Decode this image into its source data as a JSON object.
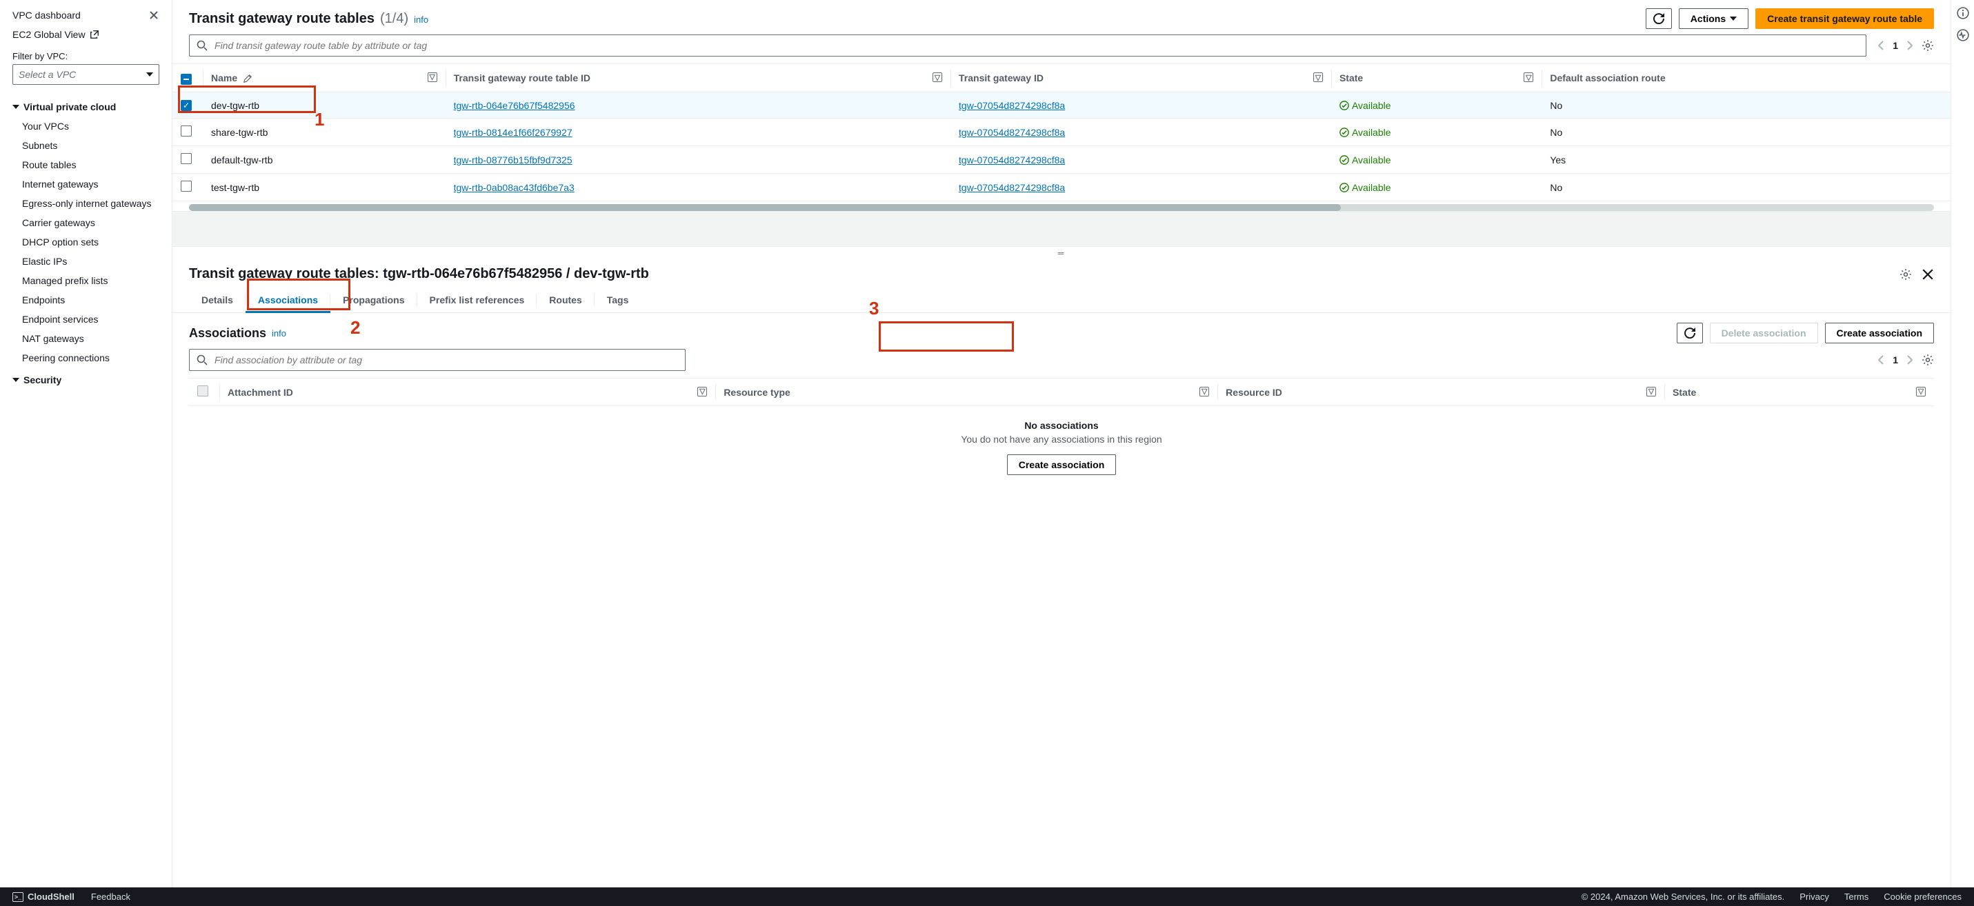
{
  "sidebar": {
    "dashboard": "VPC dashboard",
    "ec2_global": "EC2 Global View",
    "filter_label": "Filter by VPC:",
    "filter_placeholder": "Select a VPC",
    "section_vpc": "Virtual private cloud",
    "links_vpc": [
      "Your VPCs",
      "Subnets",
      "Route tables",
      "Internet gateways",
      "Egress-only internet gateways",
      "Carrier gateways",
      "DHCP option sets",
      "Elastic IPs",
      "Managed prefix lists",
      "Endpoints",
      "Endpoint services",
      "NAT gateways",
      "Peering connections"
    ],
    "section_security": "Security"
  },
  "header": {
    "title": "Transit gateway route tables",
    "count": "(1/4)",
    "info": "info",
    "actions_label": "Actions",
    "create_label": "Create transit gateway route table",
    "search_placeholder": "Find transit gateway route table by attribute or tag",
    "page": "1"
  },
  "table": {
    "cols": [
      "Name",
      "Transit gateway route table ID",
      "Transit gateway ID",
      "State",
      "Default association route"
    ],
    "rows": [
      {
        "selected": true,
        "name": "dev-tgw-rtb",
        "rtid": "tgw-rtb-064e76b67f5482956",
        "tgid": "tgw-07054d8274298cf8a",
        "state": "Available",
        "def": "No"
      },
      {
        "selected": false,
        "name": "share-tgw-rtb",
        "rtid": "tgw-rtb-0814e1f66f2679927",
        "tgid": "tgw-07054d8274298cf8a",
        "state": "Available",
        "def": "No"
      },
      {
        "selected": false,
        "name": "default-tgw-rtb",
        "rtid": "tgw-rtb-08776b15fbf9d7325",
        "tgid": "tgw-07054d8274298cf8a",
        "state": "Available",
        "def": "Yes"
      },
      {
        "selected": false,
        "name": "test-tgw-rtb",
        "rtid": "tgw-rtb-0ab08ac43fd6be7a3",
        "tgid": "tgw-07054d8274298cf8a",
        "state": "Available",
        "def": "No"
      }
    ]
  },
  "detail": {
    "title": "Transit gateway route tables: tgw-rtb-064e76b67f5482956 / dev-tgw-rtb",
    "tabs": [
      "Details",
      "Associations",
      "Propagations",
      "Prefix list references",
      "Routes",
      "Tags"
    ],
    "active_tab": 1,
    "assoc_title": "Associations",
    "info": "info",
    "delete_label": "Delete association",
    "create_label": "Create association",
    "search_placeholder": "Find association by attribute or tag",
    "page": "1",
    "cols": [
      "Attachment ID",
      "Resource type",
      "Resource ID",
      "State"
    ],
    "empty_title": "No associations",
    "empty_sub": "You do not have any associations in this region",
    "empty_btn": "Create association"
  },
  "footer": {
    "cloudshell": "CloudShell",
    "feedback": "Feedback",
    "copyright": "© 2024, Amazon Web Services, Inc. or its affiliates.",
    "privacy": "Privacy",
    "terms": "Terms",
    "cookie": "Cookie preferences"
  },
  "annotations": {
    "n1": "1",
    "n2": "2",
    "n3": "3"
  }
}
